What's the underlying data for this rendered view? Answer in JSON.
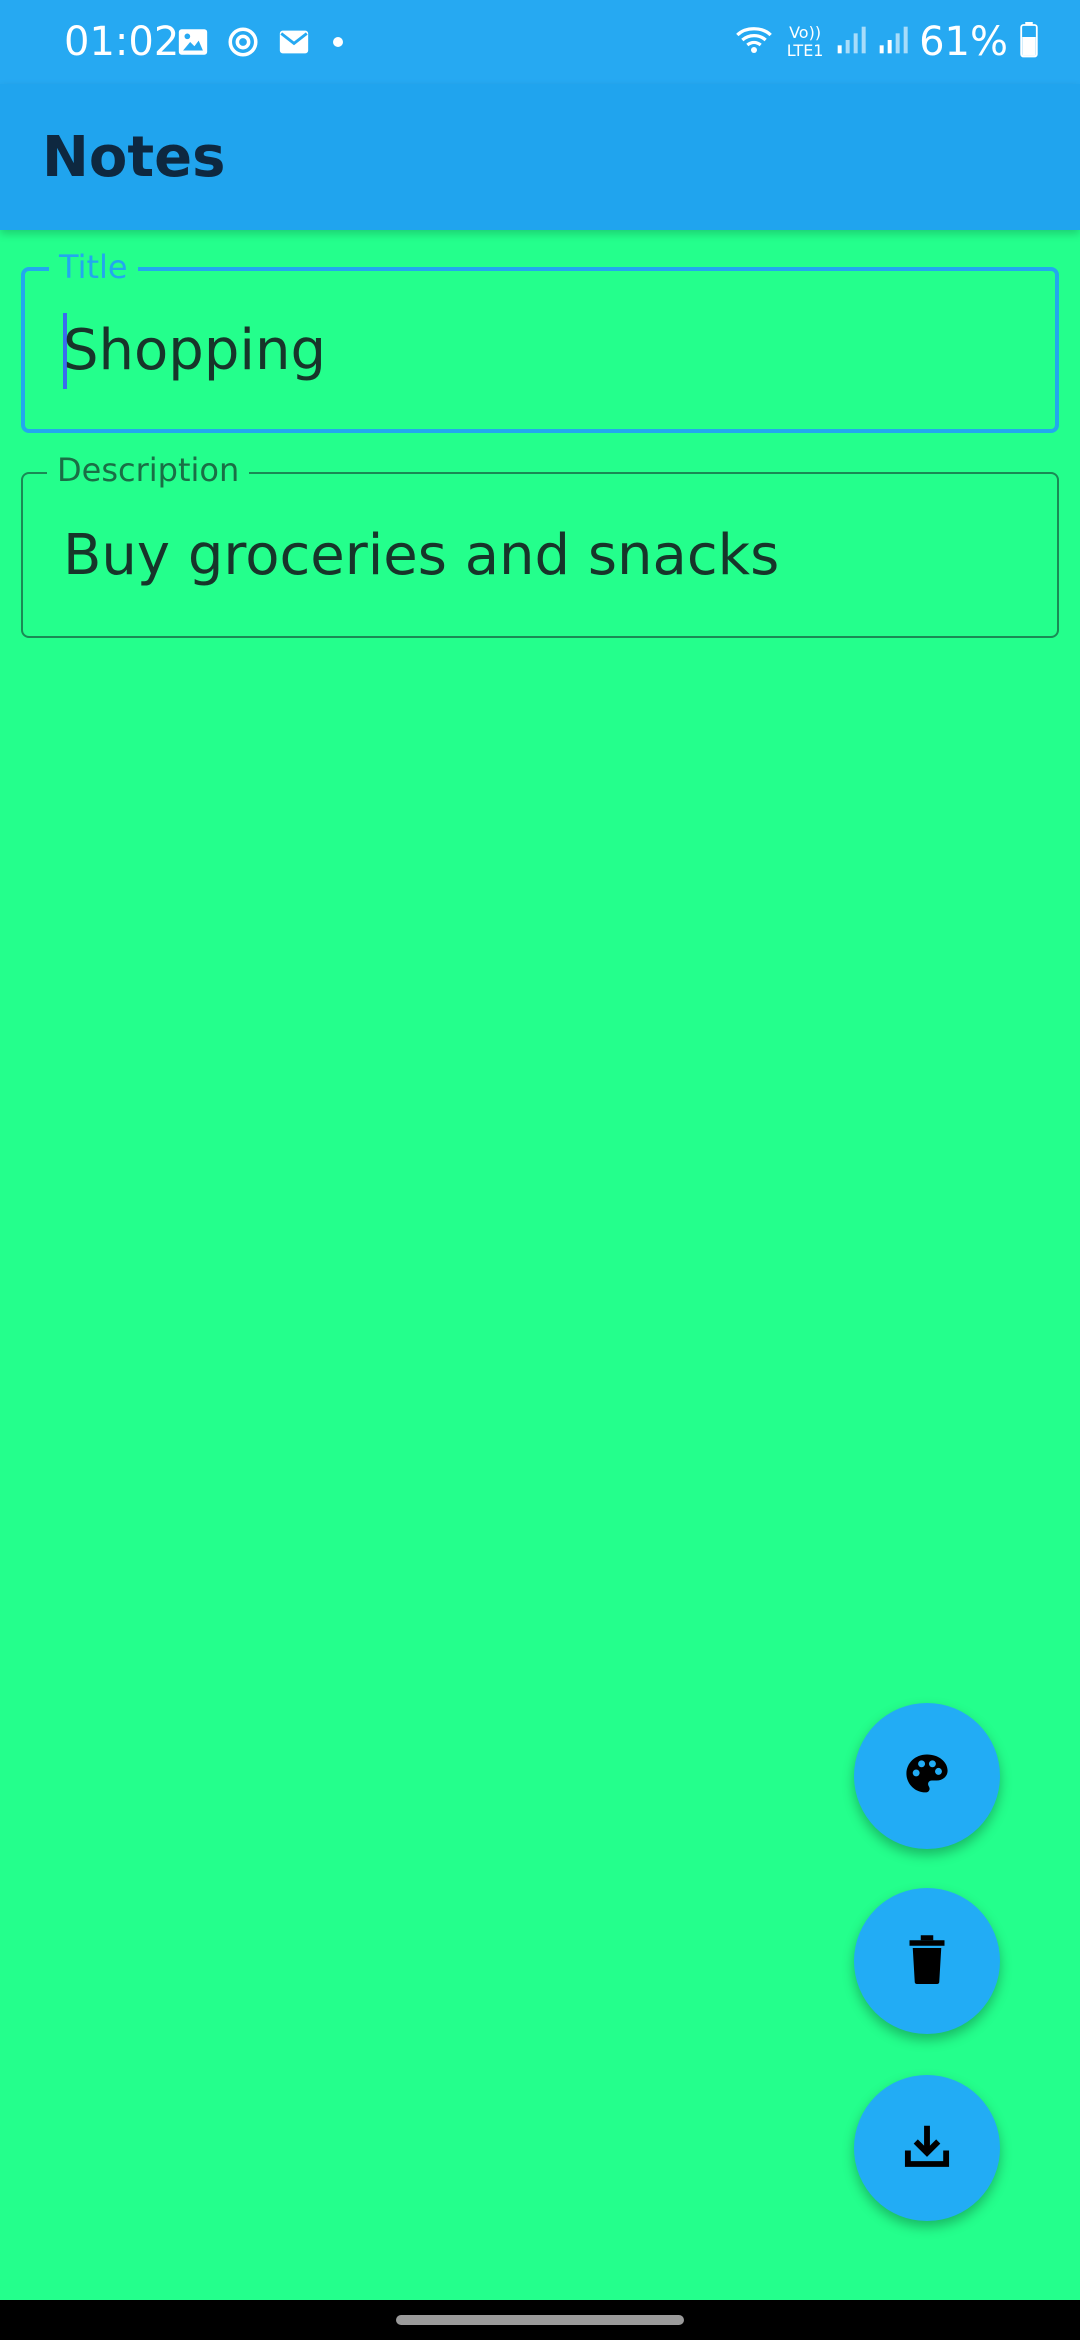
{
  "status_bar": {
    "time": "01:02",
    "battery_percent": "61%",
    "network_label": "Vo)) LTE1",
    "left_icons": [
      "image-icon",
      "sync-icon",
      "mail-icon",
      "dot-icon"
    ],
    "right_icons": [
      "wifi-icon",
      "signal-icon",
      "signal-icon",
      "battery-icon"
    ]
  },
  "app_bar": {
    "title": "Notes"
  },
  "form": {
    "title_field": {
      "label": "Title",
      "value": "Shopping"
    },
    "description_field": {
      "label": "Description",
      "value": "Buy groceries and snacks"
    }
  },
  "actions": {
    "palette_icon": "palette-icon",
    "delete_icon": "trash-icon",
    "save_icon": "download-icon"
  },
  "colors": {
    "background": "#24FF8C",
    "status_bar": "#26A9F2",
    "app_bar": "#20A4EE",
    "accent": "#22ACF5",
    "title_text": "#0E2840"
  }
}
